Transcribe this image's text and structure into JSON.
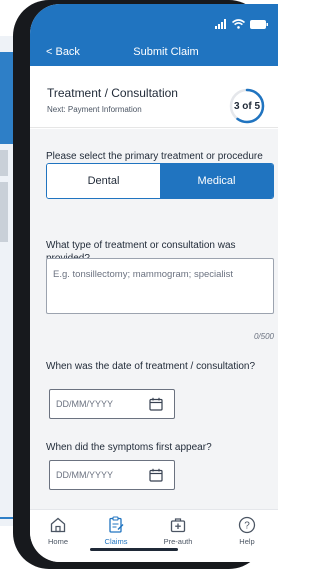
{
  "header": {
    "back_label": "< Back",
    "title": "Submit Claim"
  },
  "step": {
    "title": "Treatment / Consultation",
    "subtitle": "Next: Payment Information",
    "counter": "3 of 5",
    "progress_fraction": 0.6
  },
  "claim_type": {
    "question": "Please select the primary treatment or procedure you are claiming for",
    "options": [
      "Dental",
      "Medical"
    ],
    "selected": "Medical"
  },
  "treatment": {
    "question": "What type of treatment or consultation was provided?",
    "placeholder": "E.g. tonsillectomy; mammogram; specialist",
    "char_count": "0/500"
  },
  "treatment_date": {
    "question": "When was the date of treatment / consultation?",
    "placeholder": "DD/MM/YYYY"
  },
  "symptoms_date": {
    "question": "When did the symptoms first appear?",
    "placeholder": "DD/MM/YYYY"
  },
  "tabs": [
    {
      "label": "Home",
      "icon": "home-icon"
    },
    {
      "label": "Claims",
      "icon": "claims-icon"
    },
    {
      "label": "Pre-auth",
      "icon": "pre-auth-icon"
    },
    {
      "label": "Help",
      "icon": "help-icon"
    }
  ],
  "active_tab": "Claims",
  "colors": {
    "brand_blue": "#2074c0",
    "text": "#1f2937",
    "body_bg": "#f3f4f6"
  }
}
